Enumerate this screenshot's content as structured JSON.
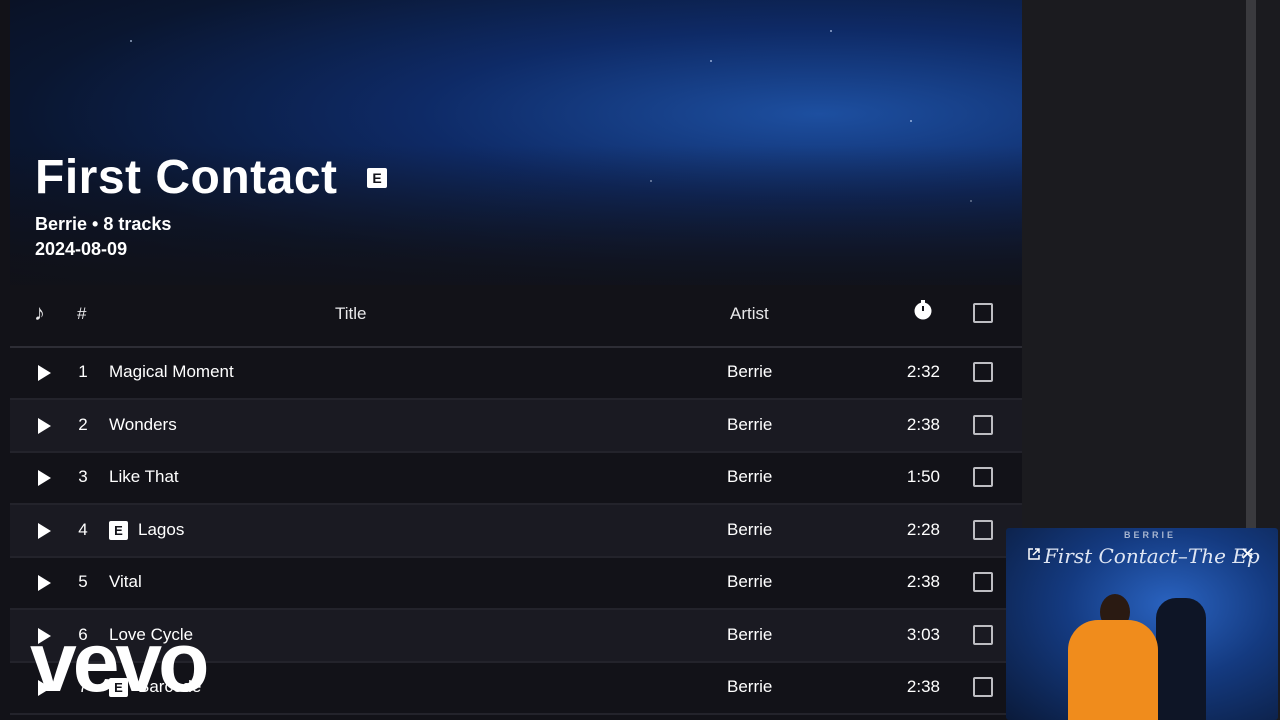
{
  "album": {
    "title": "First Contact",
    "explicit_badge": "E",
    "meta": "Berrie • 8 tracks",
    "release_date": "2024-08-09"
  },
  "table": {
    "headers": {
      "number": "#",
      "title": "Title",
      "artist": "Artist"
    },
    "tracks": [
      {
        "number": "1",
        "title": "Magical Moment",
        "artist": "Berrie",
        "duration": "2:32",
        "explicit": false
      },
      {
        "number": "2",
        "title": "Wonders",
        "artist": "Berrie",
        "duration": "2:38",
        "explicit": false
      },
      {
        "number": "3",
        "title": "Like That",
        "artist": "Berrie",
        "duration": "1:50",
        "explicit": false
      },
      {
        "number": "4",
        "title": "Lagos",
        "artist": "Berrie",
        "duration": "2:28",
        "explicit": true
      },
      {
        "number": "5",
        "title": "Vital",
        "artist": "Berrie",
        "duration": "2:38",
        "explicit": false
      },
      {
        "number": "6",
        "title": "Love Cycle",
        "artist": "Berrie",
        "duration": "3:03",
        "explicit": false
      },
      {
        "number": "7",
        "title": "Barcode",
        "artist": "Berrie",
        "duration": "2:38",
        "explicit": true
      }
    ]
  },
  "mini_player": {
    "artist_label": "BERRIE",
    "title": "First Contact–The Ep",
    "close_label": "✕"
  },
  "watermark": {
    "text": "vevo"
  },
  "colors": {
    "background": "#121218",
    "row_alt": "#1a1a22",
    "hero_blue": "#1d4fa0",
    "shirt_orange": "#f08c1c"
  }
}
